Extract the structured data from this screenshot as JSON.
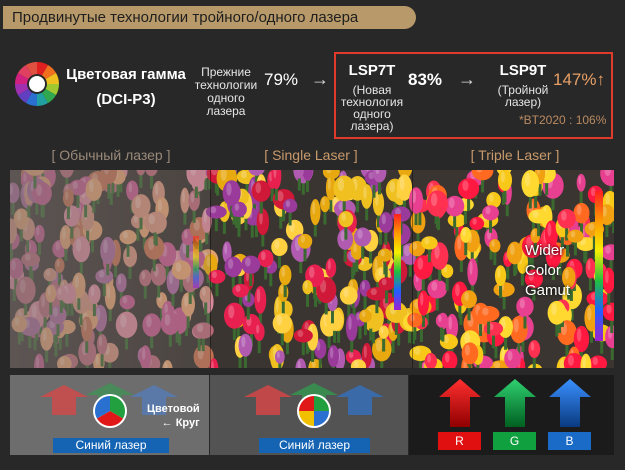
{
  "banner": {
    "title": "Продвинутые технологии тройного/одного лазера"
  },
  "gamut": {
    "title_line1": "Цветовая гамма",
    "title_line2": "(DCI-P3)",
    "prev_label": [
      "Прежние",
      "технологии",
      "одного",
      "лазера"
    ],
    "prev_value": "79%",
    "arrow": "→",
    "lsp7t": {
      "model": "LSP7T",
      "sub": [
        "(Новая",
        "технология",
        "одного",
        "лазера)"
      ],
      "value": "83%"
    },
    "lsp9t": {
      "model": "LSP9T",
      "sub": [
        "(Тройной",
        "лазер)"
      ],
      "value": "147%↑"
    },
    "bt_note": "*BT2020 : 106%"
  },
  "columns": {
    "normal": "[ Обычный лазер ]",
    "single": "[ Single Laser ]",
    "triple": "[ Triple Laser ]"
  },
  "photo": {
    "wider": [
      "Wider",
      "Color",
      "Gamut"
    ]
  },
  "panels": {
    "blue_laser": "Синий лазер",
    "color_circle": [
      "Цветовой",
      "← Круг"
    ],
    "rgb": [
      "R",
      "G",
      "B"
    ]
  },
  "colors": {
    "banner": "#b89a6a",
    "accent_orange": "#e8a066",
    "red_box": "#e03a2a",
    "blue_label": "#1564b4",
    "red": "#e01010",
    "green": "#10a040",
    "blue": "#1a6ac8"
  }
}
